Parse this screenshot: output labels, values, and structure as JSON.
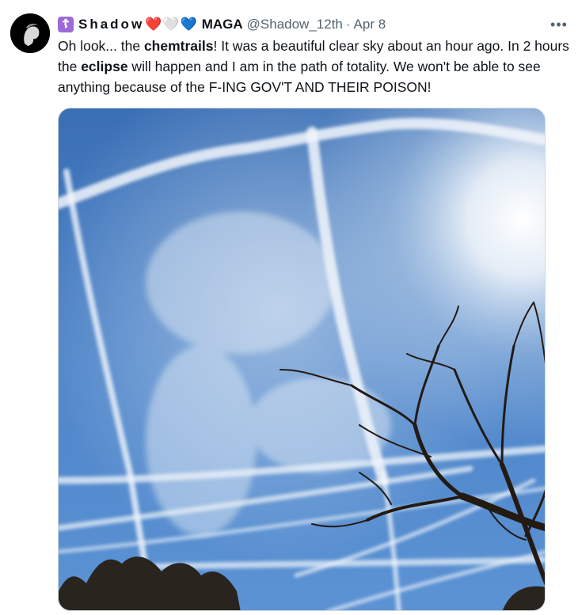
{
  "author": {
    "badge_glyph": "☦",
    "display_name": "Shadow",
    "hearts": [
      "❤️",
      "🤍",
      "💙"
    ],
    "name_suffix": "MAGA",
    "handle": "@Shadow_12th",
    "separator": "·",
    "date": "Apr 8"
  },
  "menu": {
    "more_label": "•••"
  },
  "post": {
    "text_parts": [
      {
        "t": "Oh look... the ",
        "bold": false
      },
      {
        "t": "chemtrails",
        "bold": true
      },
      {
        "t": "!  It was a beautiful clear sky about an hour ago.  In 2 hours the ",
        "bold": false
      },
      {
        "t": "eclipse",
        "bold": true
      },
      {
        "t": " will happen and I am in the path of totality.  We won't be able to see anything because of the F-ING GOV'T AND THEIR POISON!",
        "bold": false
      }
    ]
  },
  "colors": {
    "sky_top": "#3f73b8",
    "sky_bottom": "#5a8fd0",
    "badge": "#9d6ad6",
    "muted_text": "#536471"
  }
}
